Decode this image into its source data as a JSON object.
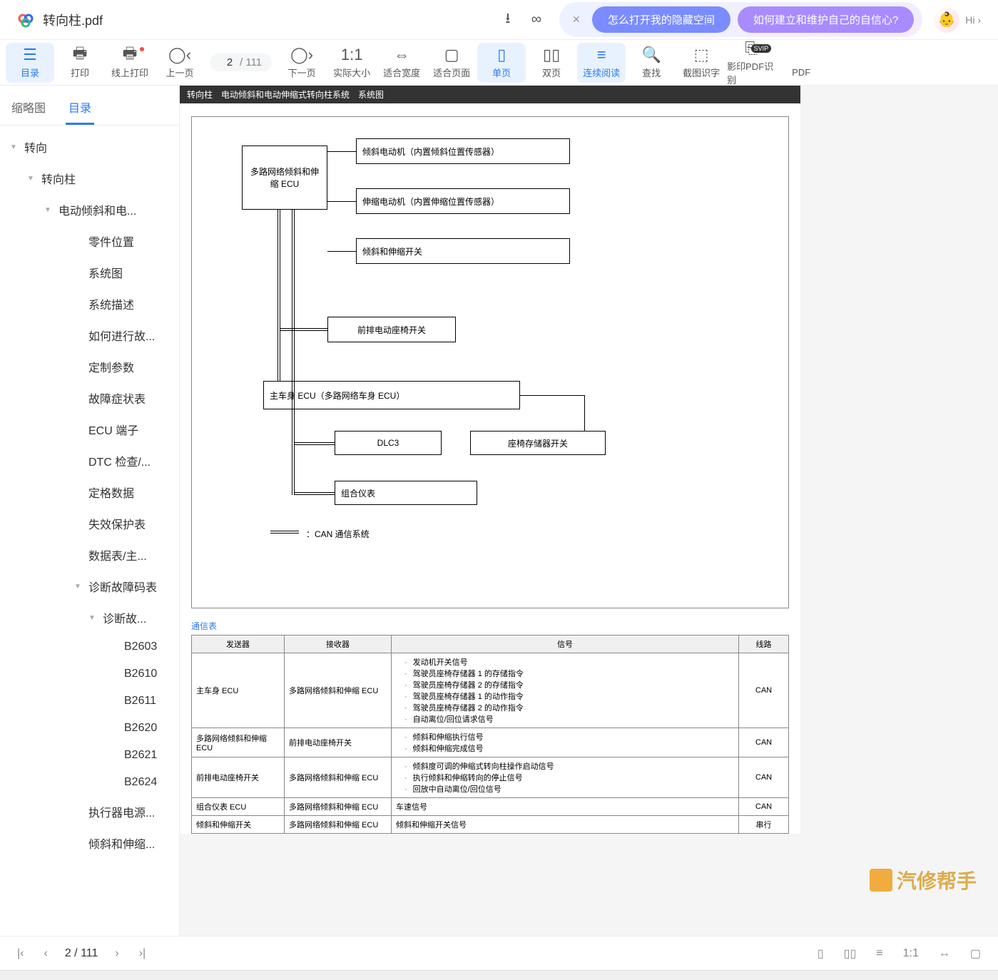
{
  "header": {
    "filename": "转向柱.pdf",
    "suggest1": "怎么打开我的隐藏空间",
    "suggest2": "如何建立和维护自己的自信心?",
    "hi": "Hi ›"
  },
  "toolbar": {
    "items": [
      {
        "icon": "☰",
        "label": "目录"
      },
      {
        "icon": "🖨",
        "label": "打印"
      },
      {
        "icon": "🖨",
        "label": "线上打印"
      },
      {
        "icon": "‹",
        "label": "上一页"
      },
      {
        "icon": "›",
        "label": "下一页"
      },
      {
        "icon": "1:1",
        "label": "实际大小"
      },
      {
        "icon": "↔",
        "label": "适合宽度"
      },
      {
        "icon": "▢",
        "label": "适合页面"
      },
      {
        "icon": "▯",
        "label": "单页"
      },
      {
        "icon": "▯▯",
        "label": "双页"
      },
      {
        "icon": "≡",
        "label": "连续阅读"
      },
      {
        "icon": "🔍",
        "label": "查找"
      },
      {
        "icon": "✂",
        "label": "截图识字"
      },
      {
        "icon": "⎘",
        "label": "影印PDF识别"
      },
      {
        "icon": "",
        "label": "PDF"
      }
    ],
    "page_current": "2",
    "page_total": "/ 111"
  },
  "sidebar": {
    "tabs": [
      "缩略图",
      "目录"
    ],
    "tree": [
      {
        "level": 0,
        "arrow": "▼",
        "label": "转向"
      },
      {
        "level": 1,
        "arrow": "▼",
        "label": "转向柱"
      },
      {
        "level": 2,
        "arrow": "▼",
        "label": "电动倾斜和电..."
      },
      {
        "level": 3,
        "arrow": "",
        "label": "零件位置"
      },
      {
        "level": 3,
        "arrow": "",
        "label": "系统图"
      },
      {
        "level": 3,
        "arrow": "",
        "label": "系统描述"
      },
      {
        "level": 3,
        "arrow": "",
        "label": "如何进行故..."
      },
      {
        "level": 3,
        "arrow": "",
        "label": "定制参数"
      },
      {
        "level": 3,
        "arrow": "",
        "label": "故障症状表"
      },
      {
        "level": 3,
        "arrow": "",
        "label": "ECU 端子"
      },
      {
        "level": 3,
        "arrow": "",
        "label": "DTC 检查/..."
      },
      {
        "level": 3,
        "arrow": "",
        "label": "定格数据"
      },
      {
        "level": 3,
        "arrow": "",
        "label": "失效保护表"
      },
      {
        "level": 3,
        "arrow": "",
        "label": "数据表/主..."
      },
      {
        "level": 3,
        "arrow": "▼",
        "label": "诊断故障码表"
      },
      {
        "level": 4,
        "arrow": "▼",
        "label": "诊断故..."
      },
      {
        "level": 5,
        "arrow": "",
        "label": "B2603"
      },
      {
        "level": 5,
        "arrow": "",
        "label": "B2610"
      },
      {
        "level": 5,
        "arrow": "",
        "label": "B2611"
      },
      {
        "level": 5,
        "arrow": "",
        "label": "B2620"
      },
      {
        "level": 5,
        "arrow": "",
        "label": "B2621"
      },
      {
        "level": 5,
        "arrow": "",
        "label": "B2624"
      },
      {
        "level": 3,
        "arrow": "",
        "label": "执行器电源..."
      },
      {
        "level": 3,
        "arrow": "",
        "label": "倾斜和伸缩..."
      }
    ]
  },
  "doc": {
    "title_bar": "转向柱　电动倾斜和电动伸缩式转向柱系统　系统图",
    "boxes": {
      "ecu": "多路网络倾斜和伸缩 ECU",
      "motor1": "倾斜电动机（内置倾斜位置传感器）",
      "motor2": "伸缩电动机（内置伸缩位置传感器）",
      "switch1": "倾斜和伸缩开关",
      "seat_switch": "前排电动座椅开关",
      "main_ecu": "主车身 ECU（多路网络车身 ECU）",
      "dlc3": "DLC3",
      "mem_switch": "座椅存储器开关",
      "meter": "组合仪表"
    },
    "can_label": "：CAN 通信系统",
    "comm_title": "通信表",
    "table": {
      "headers": [
        "发送器",
        "接收器",
        "信号",
        "线路"
      ],
      "rows": [
        {
          "tx": "主车身 ECU",
          "rx": "多路网络倾斜和伸缩 ECU",
          "sig": [
            "发动机开关信号",
            "驾驶员座椅存储器 1 的存储指令",
            "驾驶员座椅存储器 2 的存储指令",
            "驾驶员座椅存储器 1 的动作指令",
            "驾驶员座椅存储器 2 的动作指令",
            "自动离位/回位请求信号"
          ],
          "line": "CAN"
        },
        {
          "tx": "多路网络倾斜和伸缩 ECU",
          "rx": "前排电动座椅开关",
          "sig": [
            "倾斜和伸缩执行信号",
            "倾斜和伸缩完成信号"
          ],
          "line": "CAN"
        },
        {
          "tx": "前排电动座椅开关",
          "rx": "多路网络倾斜和伸缩 ECU",
          "sig": [
            "倾斜度可调的伸缩式转向柱操作启动信号",
            "执行倾斜和伸缩转向的停止信号",
            "回放中自动离位/回位信号"
          ],
          "line": "CAN"
        },
        {
          "tx": "组合仪表 ECU",
          "rx": "多路网络倾斜和伸缩 ECU",
          "sig": [
            "车速信号"
          ],
          "line": "CAN"
        },
        {
          "tx": "倾斜和伸缩开关",
          "rx": "多路网络倾斜和伸缩 ECU",
          "sig": [
            "倾斜和伸缩开关信号"
          ],
          "line": "串行"
        }
      ]
    }
  },
  "footer": {
    "page_current": "2",
    "page_total": "/ 111"
  },
  "watermark": "汽修帮手"
}
